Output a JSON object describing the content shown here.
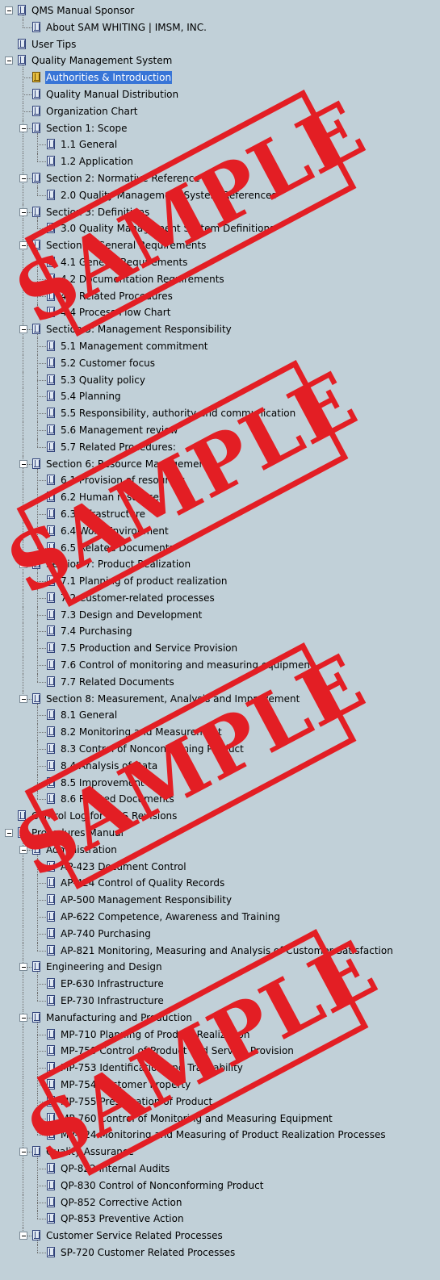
{
  "tree": [
    {
      "label": "QMS Manual Sponsor",
      "level": 0,
      "expanded": true
    },
    {
      "label": "About SAM WHITING | IMSM, INC.",
      "level": 1
    },
    {
      "label": "User Tips",
      "level": 0
    },
    {
      "label": "Quality Management System",
      "level": 0,
      "expanded": true
    },
    {
      "label": "Authorities & Introduction",
      "level": 1,
      "selected": true
    },
    {
      "label": "Quality Manual Distribution",
      "level": 1
    },
    {
      "label": "Organization Chart",
      "level": 1
    },
    {
      "label": "Section 1: Scope",
      "level": 1,
      "expanded": true
    },
    {
      "label": "1.1 General",
      "level": 2
    },
    {
      "label": "1.2 Application",
      "level": 2
    },
    {
      "label": "Section 2: Normative Reference",
      "level": 1,
      "expanded": true
    },
    {
      "label": "2.0 Quality Management System References",
      "level": 2
    },
    {
      "label": "Section 3: Definitions",
      "level": 1,
      "expanded": true
    },
    {
      "label": "3.0 Quality Management System Definitions",
      "level": 2
    },
    {
      "label": "Section 4: General Requirements",
      "level": 1,
      "expanded": true
    },
    {
      "label": "4.1 General Requirements",
      "level": 2
    },
    {
      "label": "4.2 Documentation Requirements",
      "level": 2
    },
    {
      "label": "4.3 Related Procedures",
      "level": 2
    },
    {
      "label": "4.4 Process Flow Chart",
      "level": 2
    },
    {
      "label": "Section 5: Management Responsibility",
      "level": 1,
      "expanded": true
    },
    {
      "label": "5.1 Management commitment",
      "level": 2
    },
    {
      "label": "5.2 Customer focus",
      "level": 2
    },
    {
      "label": "5.3 Quality policy",
      "level": 2
    },
    {
      "label": "5.4 Planning",
      "level": 2
    },
    {
      "label": "5.5 Responsibility, authority and communication",
      "level": 2
    },
    {
      "label": "5.6 Management review",
      "level": 2
    },
    {
      "label": "5.7 Related Procedures:",
      "level": 2
    },
    {
      "label": "Section 6: Resource Management",
      "level": 1,
      "expanded": true
    },
    {
      "label": "6.1 Provision of resources",
      "level": 2
    },
    {
      "label": "6.2 Human resources",
      "level": 2
    },
    {
      "label": "6.3 Infrastructure",
      "level": 2
    },
    {
      "label": "6.4 Work Environment",
      "level": 2
    },
    {
      "label": "6.5 Related Documents",
      "level": 2
    },
    {
      "label": "Section 7: Product Realization",
      "level": 1,
      "expanded": true
    },
    {
      "label": "7.1 Planning of product realization",
      "level": 2
    },
    {
      "label": "7.2 Customer-related processes",
      "level": 2
    },
    {
      "label": "7.3 Design and Development",
      "level": 2
    },
    {
      "label": "7.4 Purchasing",
      "level": 2
    },
    {
      "label": "7.5 Production and Service Provision",
      "level": 2
    },
    {
      "label": "7.6 Control of monitoring and measuring equipment",
      "level": 2
    },
    {
      "label": "7.7 Related Documents",
      "level": 2
    },
    {
      "label": "Section 8: Measurement, Analysis and Improvement",
      "level": 1,
      "expanded": true
    },
    {
      "label": "8.1 General",
      "level": 2
    },
    {
      "label": "8.2 Monitoring and Measurement",
      "level": 2
    },
    {
      "label": "8.3 Control of Nonconforming Product",
      "level": 2
    },
    {
      "label": "8.4 Analysis of Data",
      "level": 2
    },
    {
      "label": "8.5 Improvement",
      "level": 2
    },
    {
      "label": "8.6 Related Documents",
      "level": 2
    },
    {
      "label": "Control Log for QMS Revisions",
      "level": 0
    },
    {
      "label": "Procedures Manual",
      "level": 0,
      "expanded": true
    },
    {
      "label": "Administration",
      "level": 1,
      "expanded": true
    },
    {
      "label": "AP-423 Document Control",
      "level": 2
    },
    {
      "label": "AP-424 Control of Quality Records",
      "level": 2
    },
    {
      "label": "AP-500 Management Responsibility",
      "level": 2
    },
    {
      "label": "AP-622 Competence, Awareness and Training",
      "level": 2
    },
    {
      "label": "AP-740 Purchasing",
      "level": 2
    },
    {
      "label": "AP-821 Monitoring, Measuring and Analysis of Customer Satisfaction",
      "level": 2
    },
    {
      "label": "Engineering and Design",
      "level": 1,
      "expanded": true
    },
    {
      "label": "EP-630 Infrastructure",
      "level": 2
    },
    {
      "label": "EP-730 Infrastructure",
      "level": 2
    },
    {
      "label": "Manufacturing and Production",
      "level": 1,
      "expanded": true
    },
    {
      "label": "MP-710 Planning of Product Realization",
      "level": 2
    },
    {
      "label": "MP-750 Control of Product and Service Provision",
      "level": 2
    },
    {
      "label": "MP-753 Identification and Traceability",
      "level": 2
    },
    {
      "label": "MP-754 Customer Property",
      "level": 2
    },
    {
      "label": "MP-755 Preservation of Product",
      "level": 2
    },
    {
      "label": "MP-760 Control of Monitoring and Measuring Equipment",
      "level": 2
    },
    {
      "label": "MP-824 Monitoring and Measuring of Product Realization Processes",
      "level": 2
    },
    {
      "label": "Quality Assurance",
      "level": 1,
      "expanded": true
    },
    {
      "label": "QP-822 Internal Audits",
      "level": 2
    },
    {
      "label": "QP-830 Control of Nonconforming Product",
      "level": 2
    },
    {
      "label": "QP-852 Corrective Action",
      "level": 2
    },
    {
      "label": "QP-853 Preventive Action",
      "level": 2
    },
    {
      "label": "Customer Service Related Processes",
      "level": 1,
      "expanded": true
    },
    {
      "label": "SP-720 Customer Related Processes",
      "level": 2
    }
  ],
  "watermark": {
    "text": "SAMPLE",
    "color": "#e31e24"
  },
  "colors": {
    "background": "#c1d0d8",
    "selection": "#3875d7"
  }
}
